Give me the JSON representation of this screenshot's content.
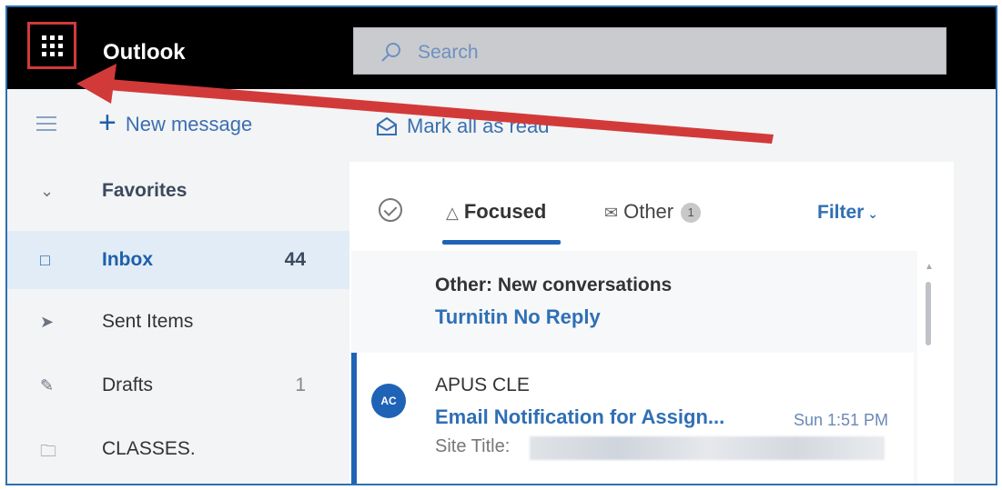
{
  "app": {
    "title": "Outlook"
  },
  "search": {
    "placeholder": "Search"
  },
  "commands": {
    "new_message": "New message",
    "mark_all_read": "Mark all as read"
  },
  "nav": {
    "items": [
      {
        "label": "Favorites",
        "icon": "chevron-down-icon",
        "count": ""
      },
      {
        "label": "Inbox",
        "icon": "inbox-icon",
        "count": "44"
      },
      {
        "label": "Sent Items",
        "icon": "send-icon",
        "count": ""
      },
      {
        "label": "Drafts",
        "icon": "pencil-icon",
        "count": "1"
      },
      {
        "label": "CLASSES.",
        "icon": "folder-icon",
        "count": ""
      }
    ]
  },
  "tabs": {
    "focused": "Focused",
    "other": "Other",
    "other_count": "1",
    "filter": "Filter"
  },
  "other_notice": {
    "title": "Other: New conversations",
    "sender": "Turnitin No Reply"
  },
  "messages": [
    {
      "initials": "AC",
      "sender": "APUS CLE",
      "subject": "Email Notification for Assign...",
      "time": "Sun 1:51 PM",
      "preview": "Site Title:"
    }
  ],
  "colors": {
    "accent": "#1f63b6",
    "annotation": "#d23a3a",
    "topbar": "#000000"
  }
}
